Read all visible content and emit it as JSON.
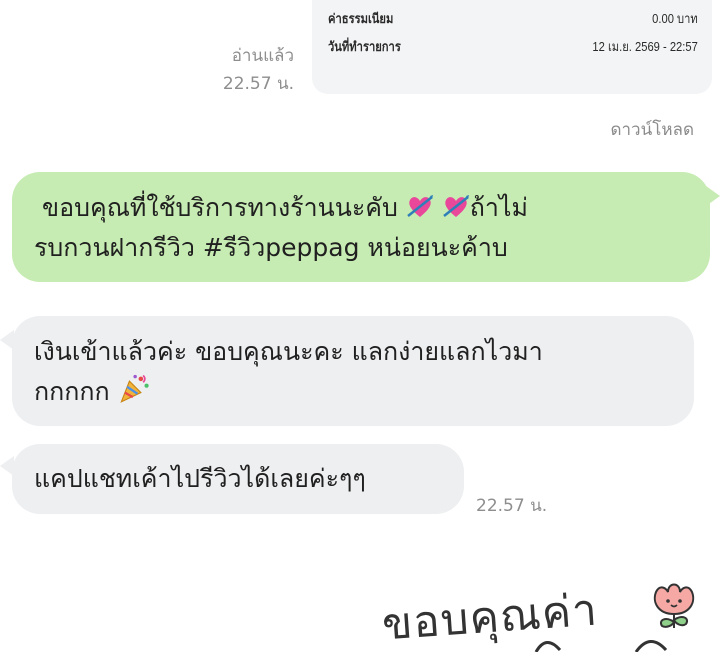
{
  "receipt": {
    "rows": [
      {
        "label": "ค่าธรรมเนียม",
        "value": "0.00 บาท"
      },
      {
        "label": "วันที่ทำรายการ",
        "value": "12 เม.ย. 2569 - 22:57"
      }
    ]
  },
  "read_receipt": {
    "status": "อ่านแล้ว",
    "time": "22.57 น."
  },
  "download_label": "ดาวน์โหลด",
  "messages": [
    {
      "direction": "outgoing",
      "line1_a": "ขอบคุณที่ใช้บริการทางร้านนะคับ",
      "line1_b": "ถ้าไม่",
      "line2": "รบกวนฝากรีวิว  #รีวิวpeppag หน่อยนะค้าบ",
      "emojis": [
        "heart-with-arrow-icon",
        "heart-with-arrow-icon"
      ]
    },
    {
      "direction": "incoming",
      "line1": "เงินเข้าแล้วค่ะ ขอบคุณนะคะ แลกง่ายแลกไวมา",
      "line2": "กกกกก",
      "emojis": [
        "party-popper-icon"
      ]
    },
    {
      "direction": "incoming",
      "line1": "แคปแชทเค้าไปรีวิวได้เลยค่ะๆๆ",
      "time": "22.57 น."
    }
  ],
  "sticker": {
    "text": "ขอบคุณค่า",
    "icon": "flower-icon"
  },
  "colors": {
    "outgoing_bubble": "#c7ecb3",
    "incoming_bubble": "#eeeff1",
    "meta_text": "#8e8e8e"
  }
}
